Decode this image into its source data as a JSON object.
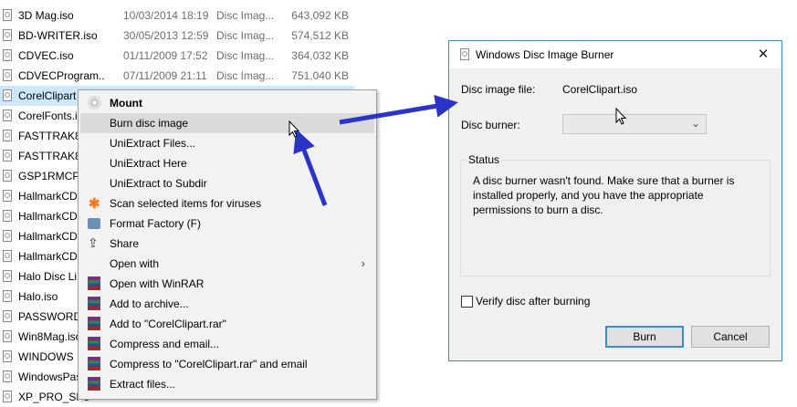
{
  "files": [
    {
      "name": "3D Mag.iso",
      "date": "10/03/2014 18:19",
      "type": "Disc Imag...",
      "size": "643,092 KB"
    },
    {
      "name": "BD-WRITER.iso",
      "date": "30/05/2013 12:59",
      "type": "Disc Imag...",
      "size": "574,512 KB"
    },
    {
      "name": "CDVEC.iso",
      "date": "01/11/2009 17:52",
      "type": "Disc Imag...",
      "size": "364,032 KB"
    },
    {
      "name": "CDVECProgram...",
      "date": "07/11/2009 21:11",
      "type": "Disc Imag...",
      "size": "751,040 KB"
    },
    {
      "name": "CorelClipart",
      "date": "",
      "type": "",
      "size": ""
    },
    {
      "name": "CorelFonts.i",
      "date": "",
      "type": "",
      "size": ""
    },
    {
      "name": "FASTTRAK80",
      "date": "",
      "type": "",
      "size": ""
    },
    {
      "name": "FASTTRAK80",
      "date": "",
      "type": "",
      "size": ""
    },
    {
      "name": "GSP1RMCPR",
      "date": "",
      "type": "",
      "size": ""
    },
    {
      "name": "HallmarkCD",
      "date": "",
      "type": "",
      "size": ""
    },
    {
      "name": "HallmarkCD",
      "date": "",
      "type": "",
      "size": ""
    },
    {
      "name": "HallmarkCD",
      "date": "",
      "type": "",
      "size": ""
    },
    {
      "name": "HallmarkCD",
      "date": "",
      "type": "",
      "size": ""
    },
    {
      "name": "Halo Disc Li",
      "date": "",
      "type": "",
      "size": ""
    },
    {
      "name": "Halo.iso",
      "date": "",
      "type": "",
      "size": ""
    },
    {
      "name": "PASSWORDU",
      "date": "",
      "type": "",
      "size": ""
    },
    {
      "name": "Win8Mag.iso",
      "date": "",
      "type": "",
      "size": ""
    },
    {
      "name": "WINDOWS 1",
      "date": "",
      "type": "",
      "size": ""
    },
    {
      "name": "WindowsPas",
      "date": "",
      "type": "",
      "size": ""
    },
    {
      "name": "XP_PRO_SP3",
      "date": "",
      "type": "",
      "size": ""
    }
  ],
  "context_menu": {
    "items": [
      {
        "label": "Mount",
        "icon": "disc-icon"
      },
      {
        "label": "Burn disc image",
        "icon": ""
      },
      {
        "label": "UniExtract Files...",
        "icon": ""
      },
      {
        "label": "UniExtract Here",
        "icon": ""
      },
      {
        "label": "UniExtract to Subdir",
        "icon": ""
      },
      {
        "label": "Scan selected items for viruses",
        "icon": "avast-icon"
      },
      {
        "label": "Format Factory (F)",
        "icon": "format-factory-icon"
      },
      {
        "label": "Share",
        "icon": "share-icon"
      },
      {
        "label": "Open with",
        "icon": ""
      },
      {
        "label": "Open with WinRAR",
        "icon": "winrar-icon"
      },
      {
        "label": "Add to archive...",
        "icon": "winrar-icon"
      },
      {
        "label": "Add to \"CorelClipart.rar\"",
        "icon": "winrar-icon"
      },
      {
        "label": "Compress and email...",
        "icon": "winrar-icon"
      },
      {
        "label": "Compress to \"CorelClipart.rar\" and email",
        "icon": "winrar-icon"
      },
      {
        "label": "Extract files...",
        "icon": "winrar-icon"
      }
    ],
    "submenu_arrow": "›"
  },
  "dialog": {
    "title": "Windows Disc Image Burner",
    "close_glyph": "✕",
    "disc_image_label": "Disc image file:",
    "disc_image_value": "CorelClipart.iso",
    "disc_burner_label": "Disc burner:",
    "disc_burner_value": "",
    "status_label": "Status",
    "status_text": "A disc burner wasn't found. Make sure that a burner is installed properly, and you have the appropriate permissions to burn a disc.",
    "verify_label": "Verify disc after burning",
    "burn_label": "Burn",
    "cancel_label": "Cancel"
  },
  "colors": {
    "annotation_arrow": "#2a35c8",
    "selection": "#cce8ff",
    "dialog_border": "#3c8ad9"
  }
}
